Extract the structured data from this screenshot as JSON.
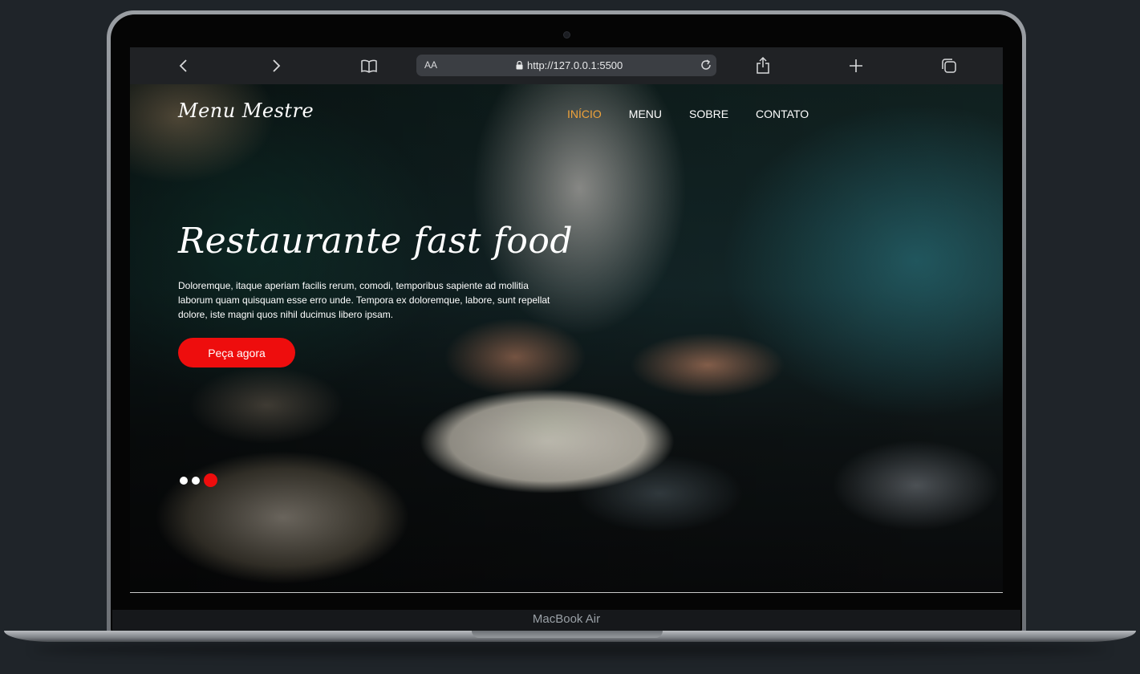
{
  "device": {
    "label": "MacBook Air"
  },
  "browser": {
    "reader_text": "AA",
    "url": "http://127.0.0.1:5500",
    "icons": [
      "back-icon",
      "forward-icon",
      "bookmarks-icon",
      "lock-icon",
      "reload-icon",
      "share-icon",
      "new-tab-icon",
      "tabs-icon"
    ]
  },
  "site": {
    "logo": "Menu Mestre",
    "nav": [
      {
        "label": "INÍCIO",
        "active": true
      },
      {
        "label": "MENU",
        "active": false
      },
      {
        "label": "SOBRE",
        "active": false
      },
      {
        "label": "CONTATO",
        "active": false
      }
    ],
    "hero": {
      "title": "Restaurante fast food",
      "text": "Doloremque, itaque aperiam facilis rerum, comodi, temporibus sapiente ad mollitia laborum quam quisquam esse erro unde. Tempora ex doloremque, labore, sunt repellat dolore, iste magni quos nihil ducimus libero ipsam.",
      "cta": "Peça agora"
    },
    "slider": {
      "count": 3,
      "active_index": 3
    }
  },
  "colors": {
    "accent": "#ee0d0d",
    "nav_active": "#f0a33a",
    "toolbar": "#202225"
  }
}
